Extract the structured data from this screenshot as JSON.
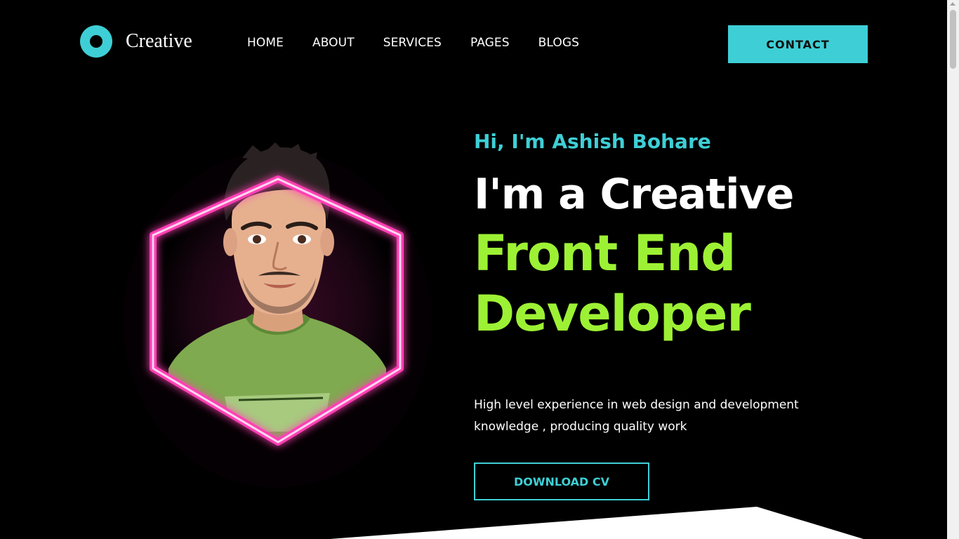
{
  "header": {
    "logo_text": "Creative",
    "nav": [
      "HOME",
      "ABOUT",
      "SERVICES",
      "PAGES",
      "BLOGS"
    ],
    "contact_label": "CONTACT"
  },
  "hero": {
    "greeting": "Hi, I'm Ashish Bohare",
    "headline_line1": "I'm a Creative",
    "headline_line2": "Front End",
    "headline_line3": "Developer",
    "description_line1": "High level experience in web design and development",
    "description_line2": "knowledge , producing quality work",
    "cv_label": "DOWNLOAD CV"
  },
  "colors": {
    "background": "#000000",
    "accent": "#3ecfd6",
    "highlight": "#9df134",
    "neon": "#ff3fb4"
  },
  "icons": {
    "logo": "ring-icon",
    "avatar": "avatar-portrait"
  }
}
